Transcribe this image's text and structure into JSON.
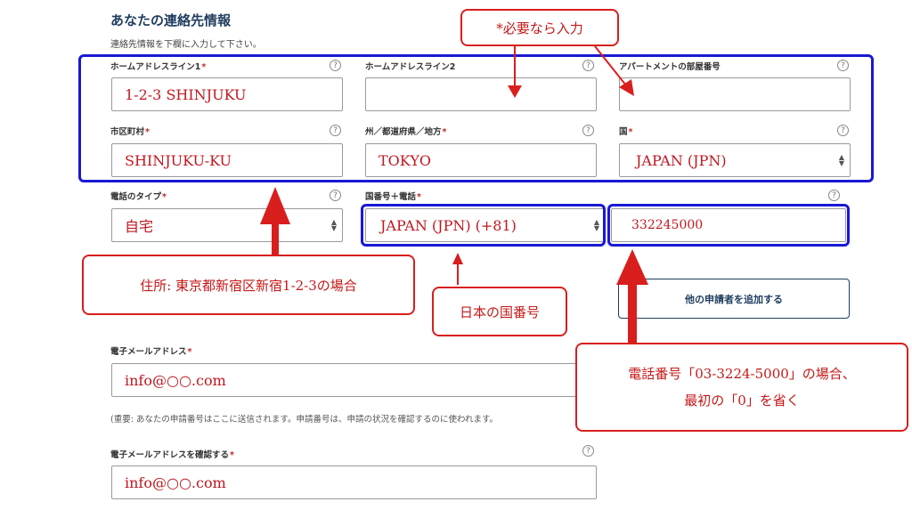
{
  "section": {
    "title": "あなたの連絡先情報",
    "subtitle": "連絡先情報を下欄に入力して下さい。"
  },
  "fields": {
    "address1": {
      "label": "ホームアドレスライン1",
      "required": "*",
      "value": "1-2-3 SHINJUKU"
    },
    "address2": {
      "label": "ホームアドレスライン2",
      "value": ""
    },
    "apartment": {
      "label": "アパートメントの部屋番号",
      "value": ""
    },
    "city": {
      "label": "市区町村",
      "required": "*",
      "value": "SHINJUKU-KU"
    },
    "state": {
      "label": "州／都道府県／地方",
      "required": "*",
      "value": "TOKYO"
    },
    "country": {
      "label": "国",
      "required": "*",
      "value": "JAPAN (JPN)"
    },
    "phone_type": {
      "label": "電話のタイプ",
      "required": "*",
      "value": "自宅"
    },
    "country_code": {
      "label": "国番号＋電話",
      "required": "*",
      "value": "JAPAN (JPN) (+81)"
    },
    "phone_number": {
      "value": "332245000"
    },
    "email": {
      "label": "電子メールアドレス",
      "required": "*",
      "value": "info@○○.com",
      "note": "(重要: あなたの申請番号はここに送信されます。申請番号は、申請の状況を確認するのに使われます。"
    },
    "email_confirm": {
      "label": "電子メールアドレスを確認する",
      "required": "*",
      "value": "info@○○.com"
    }
  },
  "help_glyph": "?",
  "add_applicant_button": "他の申請者を追加する",
  "annotations": {
    "optional": "*必要なら入力",
    "address_example": "住所: 東京都新宿区新宿1-2-3の場合",
    "country_code": "日本の国番号",
    "phone_line1": "電話番号「03-3224-5000」の場合、",
    "phone_line2": "最初の「0」を省く"
  },
  "colors": {
    "annotation_red": "#d91e1e",
    "highlight_blue": "#1a18d6",
    "title_navy": "#1f3d5e"
  }
}
